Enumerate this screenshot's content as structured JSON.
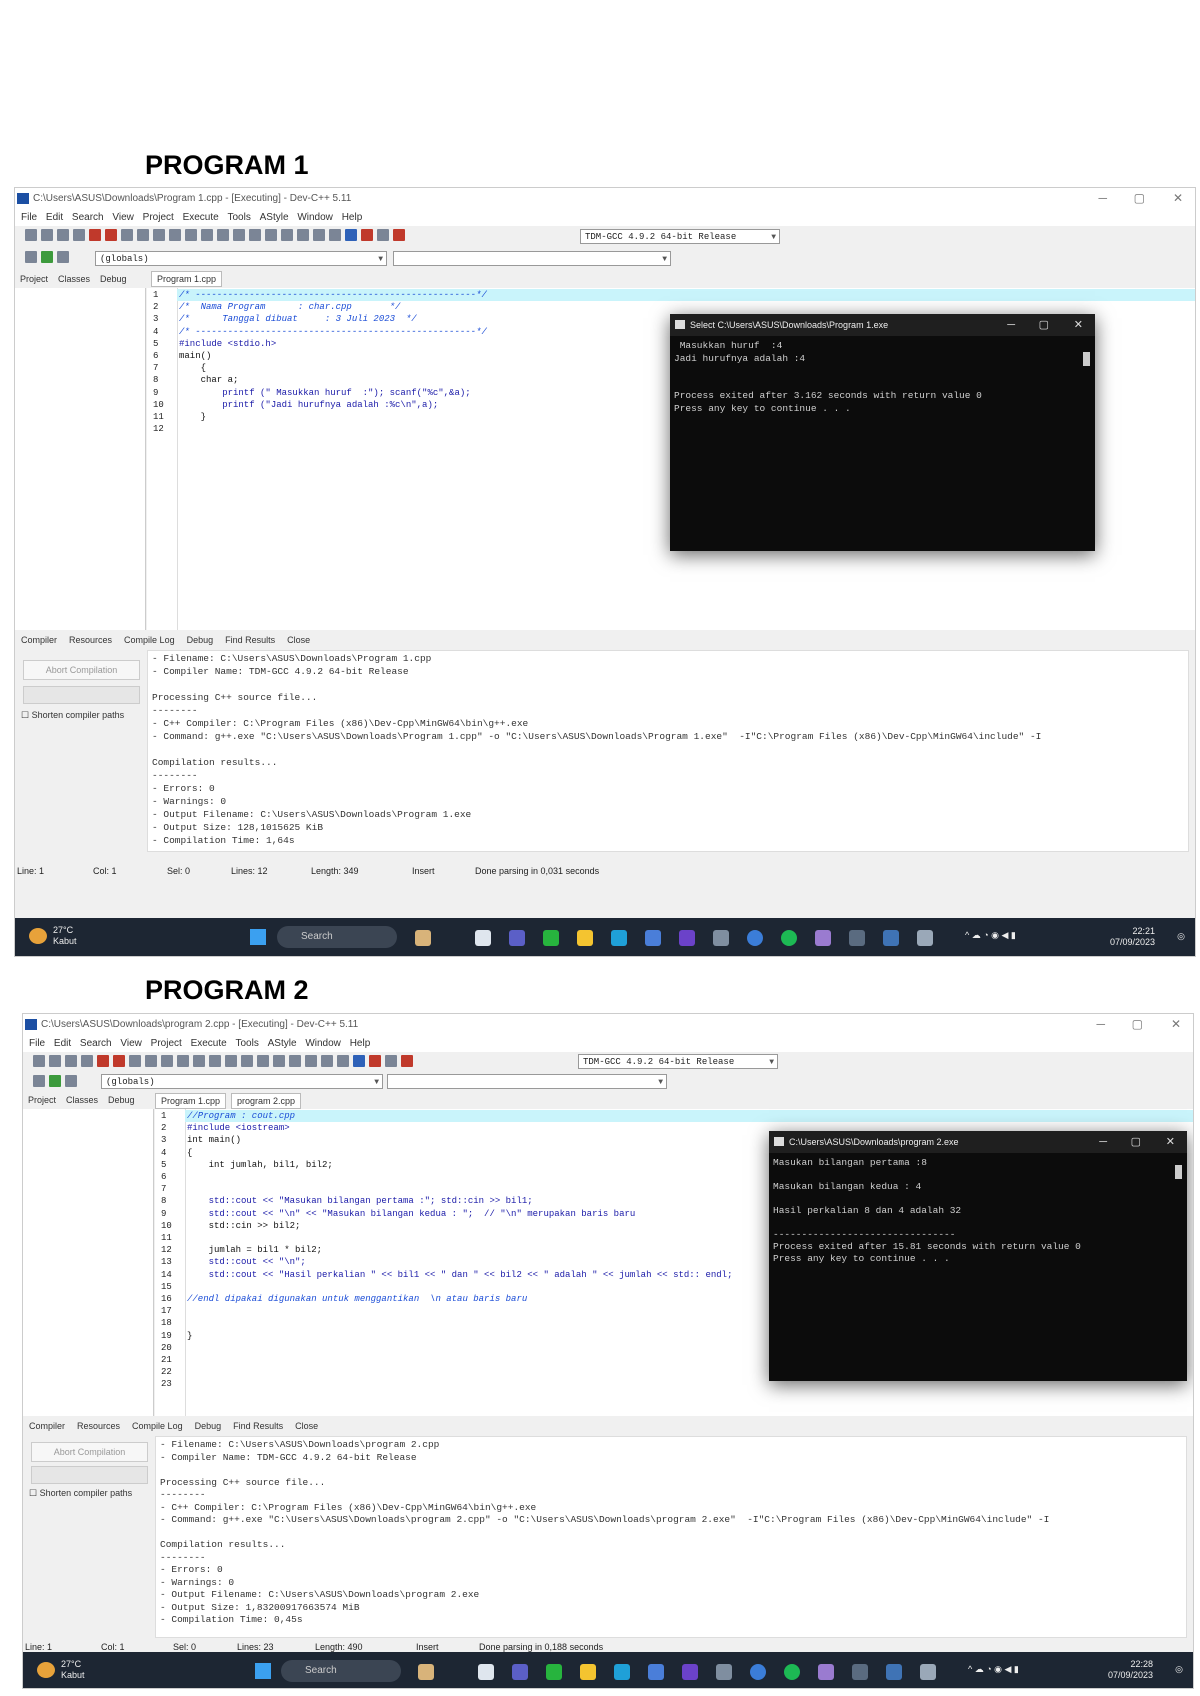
{
  "programs": [
    {
      "heading": "PROGRAM 1",
      "window_title": "C:\\Users\\ASUS\\Downloads\\Program 1.cpp - [Executing] - Dev-C++ 5.11",
      "menu": [
        "File",
        "Edit",
        "Search",
        "View",
        "Project",
        "Execute",
        "Tools",
        "AStyle",
        "Window",
        "Help"
      ],
      "compiler_combo": "TDM-GCC 4.9.2 64-bit Release",
      "globals_combo": "(globals)",
      "left_tabs": [
        "Project",
        "Classes",
        "Debug"
      ],
      "editor_tabs": [
        "Program 1.cpp"
      ],
      "code_lines": [
        {
          "n": "1",
          "t": "/* ----------------------------------------------------*/",
          "k": "cmt"
        },
        {
          "n": "2",
          "t": "/*  Nama Program      : char.cpp       */",
          "k": "cmt"
        },
        {
          "n": "3",
          "t": "/*      Tanggal dibuat     : 3 Juli 2023  */",
          "k": "cmt"
        },
        {
          "n": "4",
          "t": "/* ----------------------------------------------------*/",
          "k": "cmt"
        },
        {
          "n": "5",
          "t": "#include <stdio.h>",
          "k": "str"
        },
        {
          "n": "6",
          "t": "main()",
          "k": "plain"
        },
        {
          "n": "7",
          "t": "    {",
          "k": "plain"
        },
        {
          "n": "8",
          "t": "    char a;",
          "k": "plain"
        },
        {
          "n": "9",
          "t": "        printf (\" Masukkan huruf  :\"); scanf(\"%c\",&a);",
          "k": "str"
        },
        {
          "n": "10",
          "t": "        printf (\"Jadi hurufnya adalah :%c\\n\",a);",
          "k": "str"
        },
        {
          "n": "11",
          "t": "    }",
          "k": "plain"
        },
        {
          "n": "12",
          "t": "",
          "k": "plain"
        }
      ],
      "console_title": "Select C:\\Users\\ASUS\\Downloads\\Program 1.exe",
      "console_lines": [
        " Masukkan huruf  :4",
        "Jadi hurufnya adalah :4",
        "",
        "",
        "Process exited after 3.162 seconds with return value 0",
        "Press any key to continue . . ."
      ],
      "bottom_tabs": [
        "Compiler",
        "Resources",
        "Compile Log",
        "Debug",
        "Find Results",
        "Close"
      ],
      "abort_label": "Abort Compilation",
      "shorten_label": "Shorten compiler paths",
      "log_lines": [
        "- Filename: C:\\Users\\ASUS\\Downloads\\Program 1.cpp",
        "- Compiler Name: TDM-GCC 4.9.2 64-bit Release",
        "",
        "Processing C++ source file...",
        "--------",
        "- C++ Compiler: C:\\Program Files (x86)\\Dev-Cpp\\MinGW64\\bin\\g++.exe",
        "- Command: g++.exe \"C:\\Users\\ASUS\\Downloads\\Program 1.cpp\" -o \"C:\\Users\\ASUS\\Downloads\\Program 1.exe\"  -I\"C:\\Program Files (x86)\\Dev-Cpp\\MinGW64\\include\" -I",
        "",
        "Compilation results...",
        "--------",
        "- Errors: 0",
        "- Warnings: 0",
        "- Output Filename: C:\\Users\\ASUS\\Downloads\\Program 1.exe",
        "- Output Size: 128,1015625 KiB",
        "- Compilation Time: 1,64s"
      ],
      "status": {
        "line": "Line:   1",
        "col": "Col:   1",
        "sel": "Sel:   0",
        "lines": "Lines:   12",
        "length": "Length:   349",
        "mode": "Insert",
        "msg": "Done parsing in 0,031 seconds"
      },
      "taskbar": {
        "temp": "27°C",
        "weather": "Kabut",
        "search": "Search",
        "time": "22:21",
        "date": "07/09/2023"
      }
    },
    {
      "heading": "PROGRAM 2",
      "window_title": "C:\\Users\\ASUS\\Downloads\\program 2.cpp - [Executing] - Dev-C++ 5.11",
      "menu": [
        "File",
        "Edit",
        "Search",
        "View",
        "Project",
        "Execute",
        "Tools",
        "AStyle",
        "Window",
        "Help"
      ],
      "compiler_combo": "TDM-GCC 4.9.2 64-bit Release",
      "globals_combo": "(globals)",
      "left_tabs": [
        "Project",
        "Classes",
        "Debug"
      ],
      "editor_tabs": [
        "Program 1.cpp",
        "program 2.cpp"
      ],
      "code_lines": [
        {
          "n": "1",
          "t": "//Program : cout.cpp",
          "k": "cmt"
        },
        {
          "n": "2",
          "t": "#include <iostream>",
          "k": "str"
        },
        {
          "n": "3",
          "t": "int main()",
          "k": "plain"
        },
        {
          "n": "4",
          "t": "{",
          "k": "plain"
        },
        {
          "n": "5",
          "t": "    int jumlah, bil1, bil2;",
          "k": "plain"
        },
        {
          "n": "6",
          "t": "",
          "k": "plain"
        },
        {
          "n": "7",
          "t": "",
          "k": "plain"
        },
        {
          "n": "8",
          "t": "    std::cout << \"Masukan bilangan pertama :\"; std::cin >> bil1;",
          "k": "str"
        },
        {
          "n": "9",
          "t": "    std::cout << \"\\n\" << \"Masukan bilangan kedua : \";  // \"\\n\" merupakan baris baru",
          "k": "str"
        },
        {
          "n": "10",
          "t": "    std::cin >> bil2;",
          "k": "plain"
        },
        {
          "n": "11",
          "t": "",
          "k": "plain"
        },
        {
          "n": "12",
          "t": "    jumlah = bil1 * bil2;",
          "k": "plain"
        },
        {
          "n": "13",
          "t": "    std::cout << \"\\n\";",
          "k": "str"
        },
        {
          "n": "14",
          "t": "    std::cout << \"Hasil perkalian \" << bil1 << \" dan \" << bil2 << \" adalah \" << jumlah << std:: endl;",
          "k": "str"
        },
        {
          "n": "15",
          "t": "",
          "k": "plain"
        },
        {
          "n": "16",
          "t": "//endl dipakai digunakan untuk menggantikan  \\n atau baris baru",
          "k": "cmt"
        },
        {
          "n": "17",
          "t": "",
          "k": "plain"
        },
        {
          "n": "18",
          "t": "",
          "k": "plain"
        },
        {
          "n": "19",
          "t": "}",
          "k": "plain"
        },
        {
          "n": "20",
          "t": "",
          "k": "plain"
        },
        {
          "n": "21",
          "t": "",
          "k": "plain"
        },
        {
          "n": "22",
          "t": "",
          "k": "plain"
        },
        {
          "n": "23",
          "t": "",
          "k": "plain"
        }
      ],
      "console_title": "C:\\Users\\ASUS\\Downloads\\program 2.exe",
      "console_lines": [
        "Masukan bilangan pertama :8",
        "",
        "Masukan bilangan kedua : 4",
        "",
        "Hasil perkalian 8 dan 4 adalah 32",
        "",
        "--------------------------------",
        "Process exited after 15.81 seconds with return value 0",
        "Press any key to continue . . ."
      ],
      "bottom_tabs": [
        "Compiler",
        "Resources",
        "Compile Log",
        "Debug",
        "Find Results",
        "Close"
      ],
      "abort_label": "Abort Compilation",
      "shorten_label": "Shorten compiler paths",
      "log_lines": [
        "- Filename: C:\\Users\\ASUS\\Downloads\\program 2.cpp",
        "- Compiler Name: TDM-GCC 4.9.2 64-bit Release",
        "",
        "Processing C++ source file...",
        "--------",
        "- C++ Compiler: C:\\Program Files (x86)\\Dev-Cpp\\MinGW64\\bin\\g++.exe",
        "- Command: g++.exe \"C:\\Users\\ASUS\\Downloads\\program 2.cpp\" -o \"C:\\Users\\ASUS\\Downloads\\program 2.exe\"  -I\"C:\\Program Files (x86)\\Dev-Cpp\\MinGW64\\include\" -I",
        "",
        "Compilation results...",
        "--------",
        "- Errors: 0",
        "- Warnings: 0",
        "- Output Filename: C:\\Users\\ASUS\\Downloads\\program 2.exe",
        "- Output Size: 1,83200917663574 MiB",
        "- Compilation Time: 0,45s"
      ],
      "status": {
        "line": "Line:   1",
        "col": "Col:   1",
        "sel": "Sel:   0",
        "lines": "Lines:   23",
        "length": "Length:   490",
        "mode": "Insert",
        "msg": "Done parsing in 0,188 seconds"
      },
      "taskbar": {
        "temp": "27°C",
        "weather": "Kabut",
        "search": "Search",
        "time": "22:28",
        "date": "07/09/2023"
      }
    }
  ]
}
